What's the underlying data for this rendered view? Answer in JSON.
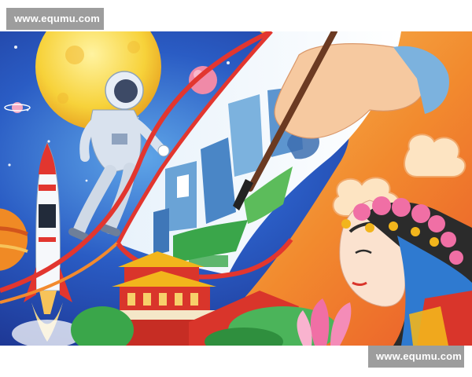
{
  "watermarks": {
    "top": "www.equmu.com",
    "bottom": "www.equmu.com"
  },
  "artwork": {
    "subject": "children's watercolor painting",
    "icons": [
      "astronaut-icon",
      "rocket-icon",
      "moon-icon",
      "planet-icon",
      "paintbrush-icon",
      "hand-icon",
      "city-buildings-icon",
      "palace-icon",
      "opera-performer-icon",
      "lotus-icon",
      "cloud-icon"
    ],
    "colors": {
      "space_blue": "#1f4fb8",
      "moon_yellow": "#f7d23a",
      "scroll_white": "#f4f8fb",
      "scroll_red": "#e2362f",
      "warm_orange": "#f28a2e",
      "palace_red": "#d9352b",
      "palace_gold": "#f2b51c",
      "lotus_pink": "#f06fa5",
      "leaf_green": "#3aa64a",
      "building_blue": "#6aa3d6"
    }
  }
}
